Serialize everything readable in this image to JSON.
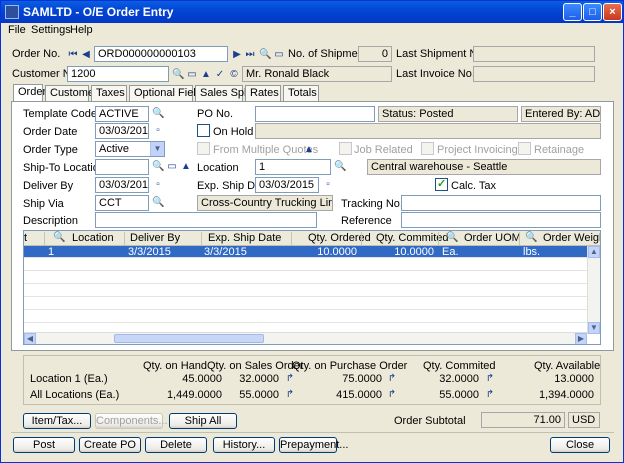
{
  "window": {
    "title": "SAMLTD - O/E Order Entry"
  },
  "menu": [
    "File",
    "Settings",
    "Help"
  ],
  "header": {
    "order_no_label": "Order No.",
    "order_no": "ORD000000000103",
    "shipments_label": "No. of Shipments",
    "shipments": "0",
    "last_shipment_label": "Last Shipment No.",
    "last_shipment": "",
    "customer_no_label": "Customer No.",
    "customer_no": "1200",
    "customer_name": "Mr. Ronald Black",
    "last_invoice_label": "Last Invoice No.",
    "last_invoice": ""
  },
  "tabs": [
    "Order",
    "Customer",
    "Taxes",
    "Optional Fields",
    "Sales Split",
    "Rates",
    "Totals"
  ],
  "order": {
    "template_code_label": "Template Code",
    "template_code": "ACTIVE",
    "po_no_label": "PO No.",
    "po_no": "",
    "status": "Status: Posted",
    "entered_by": "Entered By: ADMIN",
    "order_date_label": "Order Date",
    "order_date": "03/03/2015",
    "on_hold_label": "On Hold",
    "on_hold_reason": "",
    "order_type_label": "Order Type",
    "order_type": "Active",
    "from_multiple_quotes_label": "From Multiple Quotes",
    "job_related_label": "Job Related",
    "project_invoicing_label": "Project Invoicing",
    "retainage_label": "Retainage",
    "ship_to_location_label": "Ship-To Location",
    "ship_to_location": "",
    "location_label": "Location",
    "location": "1",
    "location_desc": "Central warehouse - Seattle",
    "deliver_by_label": "Deliver By",
    "deliver_by": "03/03/2015",
    "exp_ship_date_label": "Exp. Ship Date",
    "exp_ship_date": "03/03/2015",
    "calc_tax_label": "Calc. Tax",
    "ship_via_label": "Ship Via",
    "ship_via": "CCT",
    "ship_via_desc": "Cross-Country Trucking Lines",
    "tracking_no_label": "Tracking No.",
    "tracking_no": "",
    "description_label": "Description",
    "description": "",
    "reference_label": "Reference",
    "reference": ""
  },
  "grid": {
    "columns": [
      "t",
      "Location",
      "Deliver By",
      "Exp. Ship Date",
      "Qty. Ordered",
      "Qty. Commited",
      "Order UOM",
      "Order Weigh"
    ],
    "rows": [
      [
        "",
        "1",
        "3/3/2015",
        "3/3/2015",
        "10.0000",
        "10.0000",
        "Ea.",
        "lbs."
      ]
    ]
  },
  "summary": {
    "headers": [
      "Qty. on Hand",
      "Qty. on Sales Order",
      "Qty. on Purchase Order",
      "Qty. Commited",
      "Qty. Available"
    ],
    "rows": [
      {
        "label": "Location  1 (Ea.)",
        "values": [
          "45.0000",
          "32.0000",
          "75.0000",
          "32.0000",
          "13.0000"
        ]
      },
      {
        "label": "All Locations (Ea.)",
        "values": [
          "1,449.0000",
          "55.0000",
          "415.0000",
          "55.0000",
          "1,394.0000"
        ]
      }
    ]
  },
  "actions": {
    "item_tax": "Item/Tax...",
    "components": "Components...",
    "ship_all": "Ship All",
    "order_subtotal_label": "Order Subtotal",
    "order_subtotal": "71.00",
    "currency": "USD"
  },
  "footer": {
    "post": "Post",
    "create_po": "Create PO",
    "delete": "Delete",
    "history": "History...",
    "prepayment": "Prepayment...",
    "close": "Close"
  }
}
